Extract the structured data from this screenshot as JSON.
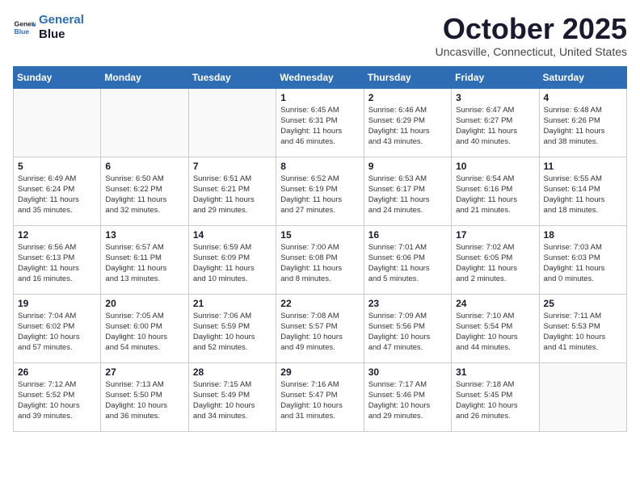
{
  "logo": {
    "line1": "General",
    "line2": "Blue"
  },
  "title": "October 2025",
  "subtitle": "Uncasville, Connecticut, United States",
  "days_of_week": [
    "Sunday",
    "Monday",
    "Tuesday",
    "Wednesday",
    "Thursday",
    "Friday",
    "Saturday"
  ],
  "weeks": [
    [
      {
        "day": "",
        "info": ""
      },
      {
        "day": "",
        "info": ""
      },
      {
        "day": "",
        "info": ""
      },
      {
        "day": "1",
        "info": "Sunrise: 6:45 AM\nSunset: 6:31 PM\nDaylight: 11 hours\nand 46 minutes."
      },
      {
        "day": "2",
        "info": "Sunrise: 6:46 AM\nSunset: 6:29 PM\nDaylight: 11 hours\nand 43 minutes."
      },
      {
        "day": "3",
        "info": "Sunrise: 6:47 AM\nSunset: 6:27 PM\nDaylight: 11 hours\nand 40 minutes."
      },
      {
        "day": "4",
        "info": "Sunrise: 6:48 AM\nSunset: 6:26 PM\nDaylight: 11 hours\nand 38 minutes."
      }
    ],
    [
      {
        "day": "5",
        "info": "Sunrise: 6:49 AM\nSunset: 6:24 PM\nDaylight: 11 hours\nand 35 minutes."
      },
      {
        "day": "6",
        "info": "Sunrise: 6:50 AM\nSunset: 6:22 PM\nDaylight: 11 hours\nand 32 minutes."
      },
      {
        "day": "7",
        "info": "Sunrise: 6:51 AM\nSunset: 6:21 PM\nDaylight: 11 hours\nand 29 minutes."
      },
      {
        "day": "8",
        "info": "Sunrise: 6:52 AM\nSunset: 6:19 PM\nDaylight: 11 hours\nand 27 minutes."
      },
      {
        "day": "9",
        "info": "Sunrise: 6:53 AM\nSunset: 6:17 PM\nDaylight: 11 hours\nand 24 minutes."
      },
      {
        "day": "10",
        "info": "Sunrise: 6:54 AM\nSunset: 6:16 PM\nDaylight: 11 hours\nand 21 minutes."
      },
      {
        "day": "11",
        "info": "Sunrise: 6:55 AM\nSunset: 6:14 PM\nDaylight: 11 hours\nand 18 minutes."
      }
    ],
    [
      {
        "day": "12",
        "info": "Sunrise: 6:56 AM\nSunset: 6:13 PM\nDaylight: 11 hours\nand 16 minutes."
      },
      {
        "day": "13",
        "info": "Sunrise: 6:57 AM\nSunset: 6:11 PM\nDaylight: 11 hours\nand 13 minutes."
      },
      {
        "day": "14",
        "info": "Sunrise: 6:59 AM\nSunset: 6:09 PM\nDaylight: 11 hours\nand 10 minutes."
      },
      {
        "day": "15",
        "info": "Sunrise: 7:00 AM\nSunset: 6:08 PM\nDaylight: 11 hours\nand 8 minutes."
      },
      {
        "day": "16",
        "info": "Sunrise: 7:01 AM\nSunset: 6:06 PM\nDaylight: 11 hours\nand 5 minutes."
      },
      {
        "day": "17",
        "info": "Sunrise: 7:02 AM\nSunset: 6:05 PM\nDaylight: 11 hours\nand 2 minutes."
      },
      {
        "day": "18",
        "info": "Sunrise: 7:03 AM\nSunset: 6:03 PM\nDaylight: 11 hours\nand 0 minutes."
      }
    ],
    [
      {
        "day": "19",
        "info": "Sunrise: 7:04 AM\nSunset: 6:02 PM\nDaylight: 10 hours\nand 57 minutes."
      },
      {
        "day": "20",
        "info": "Sunrise: 7:05 AM\nSunset: 6:00 PM\nDaylight: 10 hours\nand 54 minutes."
      },
      {
        "day": "21",
        "info": "Sunrise: 7:06 AM\nSunset: 5:59 PM\nDaylight: 10 hours\nand 52 minutes."
      },
      {
        "day": "22",
        "info": "Sunrise: 7:08 AM\nSunset: 5:57 PM\nDaylight: 10 hours\nand 49 minutes."
      },
      {
        "day": "23",
        "info": "Sunrise: 7:09 AM\nSunset: 5:56 PM\nDaylight: 10 hours\nand 47 minutes."
      },
      {
        "day": "24",
        "info": "Sunrise: 7:10 AM\nSunset: 5:54 PM\nDaylight: 10 hours\nand 44 minutes."
      },
      {
        "day": "25",
        "info": "Sunrise: 7:11 AM\nSunset: 5:53 PM\nDaylight: 10 hours\nand 41 minutes."
      }
    ],
    [
      {
        "day": "26",
        "info": "Sunrise: 7:12 AM\nSunset: 5:52 PM\nDaylight: 10 hours\nand 39 minutes."
      },
      {
        "day": "27",
        "info": "Sunrise: 7:13 AM\nSunset: 5:50 PM\nDaylight: 10 hours\nand 36 minutes."
      },
      {
        "day": "28",
        "info": "Sunrise: 7:15 AM\nSunset: 5:49 PM\nDaylight: 10 hours\nand 34 minutes."
      },
      {
        "day": "29",
        "info": "Sunrise: 7:16 AM\nSunset: 5:47 PM\nDaylight: 10 hours\nand 31 minutes."
      },
      {
        "day": "30",
        "info": "Sunrise: 7:17 AM\nSunset: 5:46 PM\nDaylight: 10 hours\nand 29 minutes."
      },
      {
        "day": "31",
        "info": "Sunrise: 7:18 AM\nSunset: 5:45 PM\nDaylight: 10 hours\nand 26 minutes."
      },
      {
        "day": "",
        "info": ""
      }
    ]
  ]
}
